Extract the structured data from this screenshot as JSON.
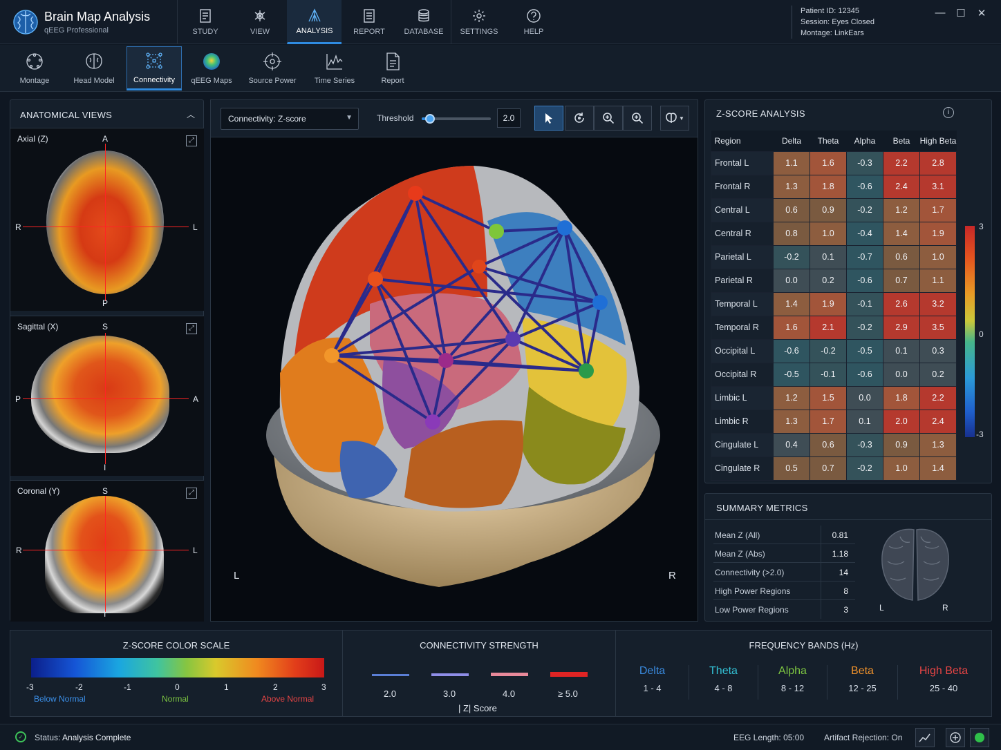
{
  "app": {
    "title": "Brain Map Analysis",
    "subtitle": "qEEG Professional"
  },
  "nav": [
    {
      "label": "STUDY",
      "icon": "study-icon"
    },
    {
      "label": "VIEW",
      "icon": "view-icon"
    },
    {
      "label": "ANALYSIS",
      "icon": "analysis-icon",
      "active": true
    },
    {
      "label": "REPORT",
      "icon": "report-icon"
    },
    {
      "label": "DATABASE",
      "icon": "database-icon"
    },
    {
      "label": "SETTINGS",
      "icon": "gear-icon"
    },
    {
      "label": "HELP",
      "icon": "help-icon"
    }
  ],
  "patient": {
    "id_label": "Patient ID:",
    "id": "12345",
    "session_label": "Session:",
    "session": "Eyes Closed",
    "montage_label": "Montage:",
    "montage": "LinkEars"
  },
  "tools": [
    {
      "label": "Montage",
      "icon": "montage-icon"
    },
    {
      "label": "Head Model",
      "icon": "head-model-icon"
    },
    {
      "label": "Connectivity",
      "icon": "connectivity-icon",
      "active": true
    },
    {
      "label": "qEEG Maps",
      "icon": "qeeg-maps-icon"
    },
    {
      "label": "Source Power",
      "icon": "source-power-icon"
    },
    {
      "label": "Time Series",
      "icon": "time-series-icon"
    },
    {
      "label": "Report",
      "icon": "report-icon"
    }
  ],
  "anatomical": {
    "title": "ANATOMICAL VIEWS",
    "views": [
      {
        "label": "Axial (Z)",
        "top": "A",
        "bottom": "P",
        "left": "R",
        "right": "L"
      },
      {
        "label": "Sagittal (X)",
        "top": "S",
        "bottom": "I",
        "left": "P",
        "right": "A"
      },
      {
        "label": "Coronal (Y)",
        "top": "S",
        "bottom": "I",
        "left": "R",
        "right": "L"
      }
    ]
  },
  "viewer": {
    "connectivity_label": "Connectivity:",
    "connectivity_value": "Z-score",
    "threshold_label": "Threshold",
    "threshold_value": "2.0",
    "threshold_fraction": 0.12,
    "left_label": "L",
    "right_label": "R"
  },
  "zscore": {
    "title": "Z-SCORE ANALYSIS",
    "headers": [
      "Region",
      "Delta",
      "Theta",
      "Alpha",
      "Beta",
      "High Beta"
    ],
    "rows": [
      {
        "region": "Frontal L",
        "values": [
          "1.1",
          "1.6",
          "-0.3",
          "2.2",
          "2.8"
        ]
      },
      {
        "region": "Frontal R",
        "values": [
          "1.3",
          "1.8",
          "-0.6",
          "2.4",
          "3.1"
        ]
      },
      {
        "region": "Central L",
        "values": [
          "0.6",
          "0.9",
          "-0.2",
          "1.2",
          "1.7"
        ]
      },
      {
        "region": "Central R",
        "values": [
          "0.8",
          "1.0",
          "-0.4",
          "1.4",
          "1.9"
        ]
      },
      {
        "region": "Parietal L",
        "values": [
          "-0.2",
          "0.1",
          "-0.7",
          "0.6",
          "1.0"
        ]
      },
      {
        "region": "Parietal R",
        "values": [
          "0.0",
          "0.2",
          "-0.6",
          "0.7",
          "1.1"
        ]
      },
      {
        "region": "Temporal L",
        "values": [
          "1.4",
          "1.9",
          "-0.1",
          "2.6",
          "3.2"
        ]
      },
      {
        "region": "Temporal R",
        "values": [
          "1.6",
          "2.1",
          "-0.2",
          "2.9",
          "3.5"
        ]
      },
      {
        "region": "Occipital L",
        "values": [
          "-0.6",
          "-0.2",
          "-0.5",
          "0.1",
          "0.3"
        ]
      },
      {
        "region": "Occipital R",
        "values": [
          "-0.5",
          "-0.1",
          "-0.6",
          "0.0",
          "0.2"
        ]
      },
      {
        "region": "Limbic L",
        "values": [
          "1.2",
          "1.5",
          "0.0",
          "1.8",
          "2.2"
        ]
      },
      {
        "region": "Limbic R",
        "values": [
          "1.3",
          "1.7",
          "0.1",
          "2.0",
          "2.4"
        ]
      },
      {
        "region": "Cingulate L",
        "values": [
          "0.4",
          "0.6",
          "-0.3",
          "0.9",
          "1.3"
        ]
      },
      {
        "region": "Cingulate R",
        "values": [
          "0.5",
          "0.7",
          "-0.2",
          "1.0",
          "1.4"
        ]
      }
    ],
    "colorbar_ticks": [
      "3",
      "0",
      "-3"
    ]
  },
  "summary": {
    "title": "SUMMARY METRICS",
    "metrics": [
      {
        "label": "Mean Z (All)",
        "value": "0.81"
      },
      {
        "label": "Mean Z (Abs)",
        "value": "1.18"
      },
      {
        "label": "Connectivity (>2.0)",
        "value": "14"
      },
      {
        "label": "High Power Regions",
        "value": "8"
      },
      {
        "label": "Low Power Regions",
        "value": "3"
      }
    ],
    "brain_left": "L",
    "brain_right": "R"
  },
  "colorscale": {
    "title": "Z-SCORE COLOR SCALE",
    "ticks": [
      "-3",
      "-2",
      "-1",
      "0",
      "1",
      "2",
      "3"
    ],
    "below": "Below Normal",
    "normal": "Normal",
    "above": "Above Normal"
  },
  "connectivity_strength": {
    "title": "CONNECTIVITY STRENGTH",
    "items": [
      {
        "label": "2.0",
        "color": "#5b7fd6"
      },
      {
        "label": "3.0",
        "color": "#8f8ee8"
      },
      {
        "label": "4.0",
        "color": "#e8899a"
      },
      {
        "label": "≥ 5.0",
        "color": "#e02424"
      }
    ],
    "caption": "| Z| Score"
  },
  "bands": {
    "title": "FREQUENCY BANDS (Hz)",
    "items": [
      {
        "name": "Delta",
        "range": "1 - 4",
        "color": "#3a8be0"
      },
      {
        "name": "Theta",
        "range": "4 - 8",
        "color": "#33c2d6"
      },
      {
        "name": "Alpha",
        "range": "8 - 12",
        "color": "#7cc441"
      },
      {
        "name": "Beta",
        "range": "12 - 25",
        "color": "#f0922b"
      },
      {
        "name": "High Beta",
        "range": "25 - 40",
        "color": "#e84545"
      }
    ]
  },
  "status": {
    "label": "Status:",
    "value": "Analysis Complete",
    "eeg_label": "EEG Length:",
    "eeg_value": "05:00",
    "artifact_label": "Artifact Rejection:",
    "artifact_value": "On"
  }
}
